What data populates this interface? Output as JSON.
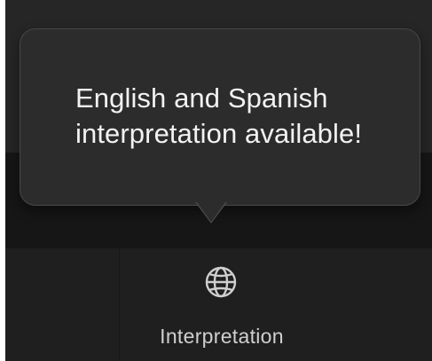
{
  "tooltip": {
    "line1": "English and Spanish",
    "line2": "interpretation available!"
  },
  "toolbar": {
    "interpretation": {
      "label": "Interpretation",
      "icon": "globe-icon"
    }
  },
  "colors": {
    "background": "#1b1b1b",
    "tooltip_bg": "#2c2c2c",
    "tooltip_border": "#474747",
    "text": "#f2f2f2",
    "label": "#cfcfcf"
  }
}
